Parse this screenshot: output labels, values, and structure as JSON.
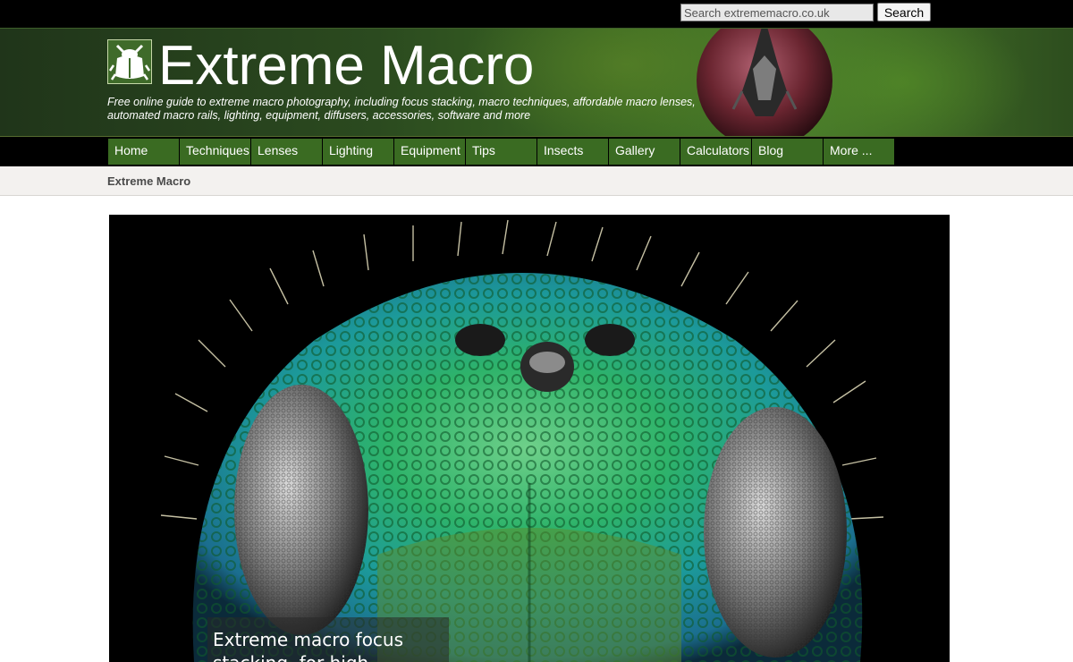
{
  "search": {
    "placeholder": "Search extrememacro.co.uk",
    "button_label": "Search"
  },
  "header": {
    "title": "Extreme Macro",
    "tagline": "Free online guide to extreme macro photography, including focus stacking, macro techniques, affordable macro lenses, automated macro rails, lighting, equipment, diffusers, accessories, software and more"
  },
  "nav": {
    "items": [
      {
        "label": "Home"
      },
      {
        "label": "Techniques"
      },
      {
        "label": "Lenses"
      },
      {
        "label": "Lighting"
      },
      {
        "label": "Equipment"
      },
      {
        "label": "Tips"
      },
      {
        "label": "Insects"
      },
      {
        "label": "Gallery"
      },
      {
        "label": "Calculators"
      },
      {
        "label": "Blog"
      },
      {
        "label": "More ..."
      }
    ]
  },
  "breadcrumb": {
    "current": "Extreme Macro"
  },
  "hero": {
    "caption": "Extreme macro focus stacking, for high"
  },
  "colors": {
    "nav_green": "#3a6b22",
    "header_dark": "#20351a",
    "top_bar": "#000000",
    "breadcrumb_bg": "#f3f1ef"
  },
  "icons": {
    "logo": "fly-logo-icon",
    "banner": "fly-head-image"
  }
}
